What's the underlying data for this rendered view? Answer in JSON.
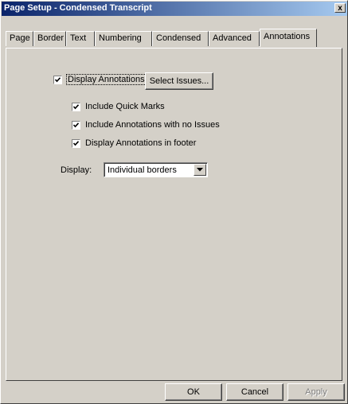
{
  "window": {
    "title": "Page Setup - Condensed Transcript",
    "close_glyph": "x"
  },
  "tabs": [
    "Page",
    "Border",
    "Text",
    "Numbering",
    "Condensed",
    "Advanced",
    "Annotations"
  ],
  "active_tab": "Annotations",
  "annotations": {
    "display_annotations": {
      "label": "Display Annotations",
      "checked": true
    },
    "select_issues_button": "Select Issues...",
    "include_quick_marks": {
      "label": "Include Quick Marks",
      "checked": true
    },
    "include_no_issues": {
      "label": "Include Annotations with no Issues",
      "checked": true
    },
    "display_in_footer": {
      "label": "Display Annotations in footer",
      "checked": true
    },
    "display_label": "Display:",
    "display_value": "Individual borders"
  },
  "buttons": {
    "ok": "OK",
    "cancel": "Cancel",
    "apply": "Apply"
  }
}
